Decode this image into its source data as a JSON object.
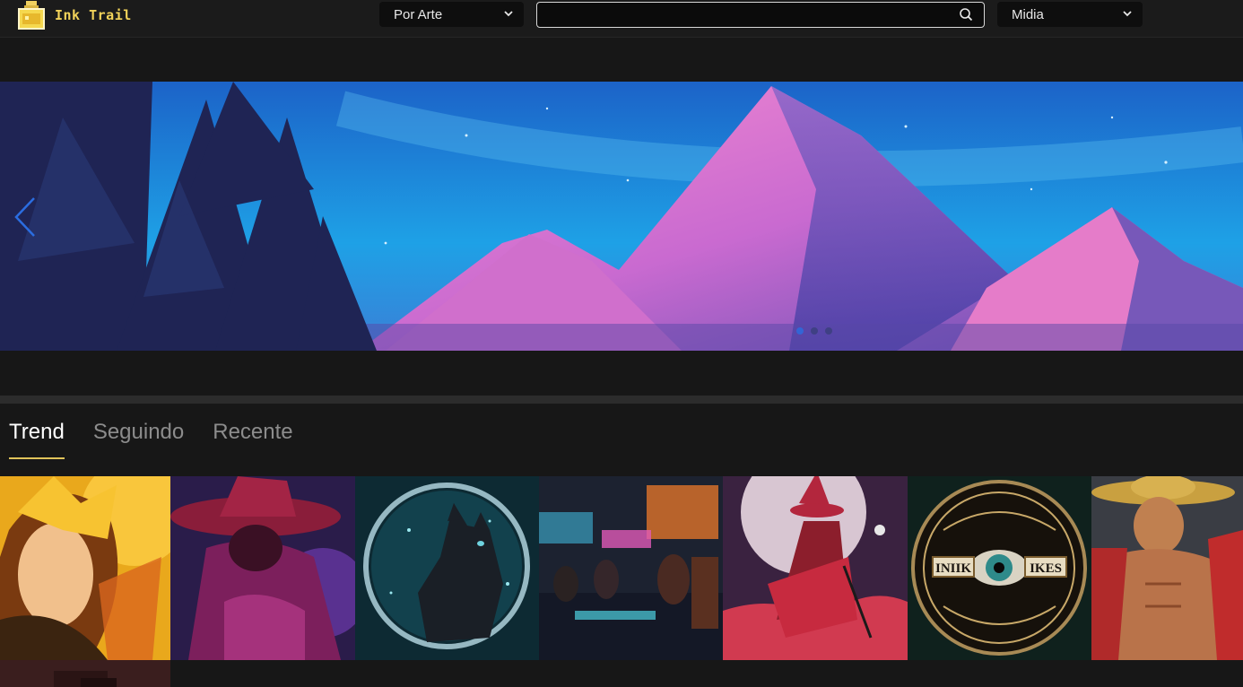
{
  "header": {
    "logo_text": "Ink Trail",
    "art_select": {
      "selected": "Por Arte"
    },
    "search": {
      "value": "",
      "placeholder": ""
    },
    "media_select": {
      "selected": "Midia"
    }
  },
  "hero": {
    "slides_count": 3,
    "active_slide": 1
  },
  "tabs": [
    {
      "label": "Trend",
      "active": true
    },
    {
      "label": "Seguindo",
      "active": false
    },
    {
      "label": "Recente",
      "active": false
    }
  ],
  "gallery": {
    "badge_text": [
      "INIIK",
      "IKES"
    ]
  },
  "colors": {
    "background": "#171717",
    "accent_underline": "#e0c35a",
    "logo_yellow": "#f2d35a",
    "carousel_arrow": "#2b6de0"
  }
}
